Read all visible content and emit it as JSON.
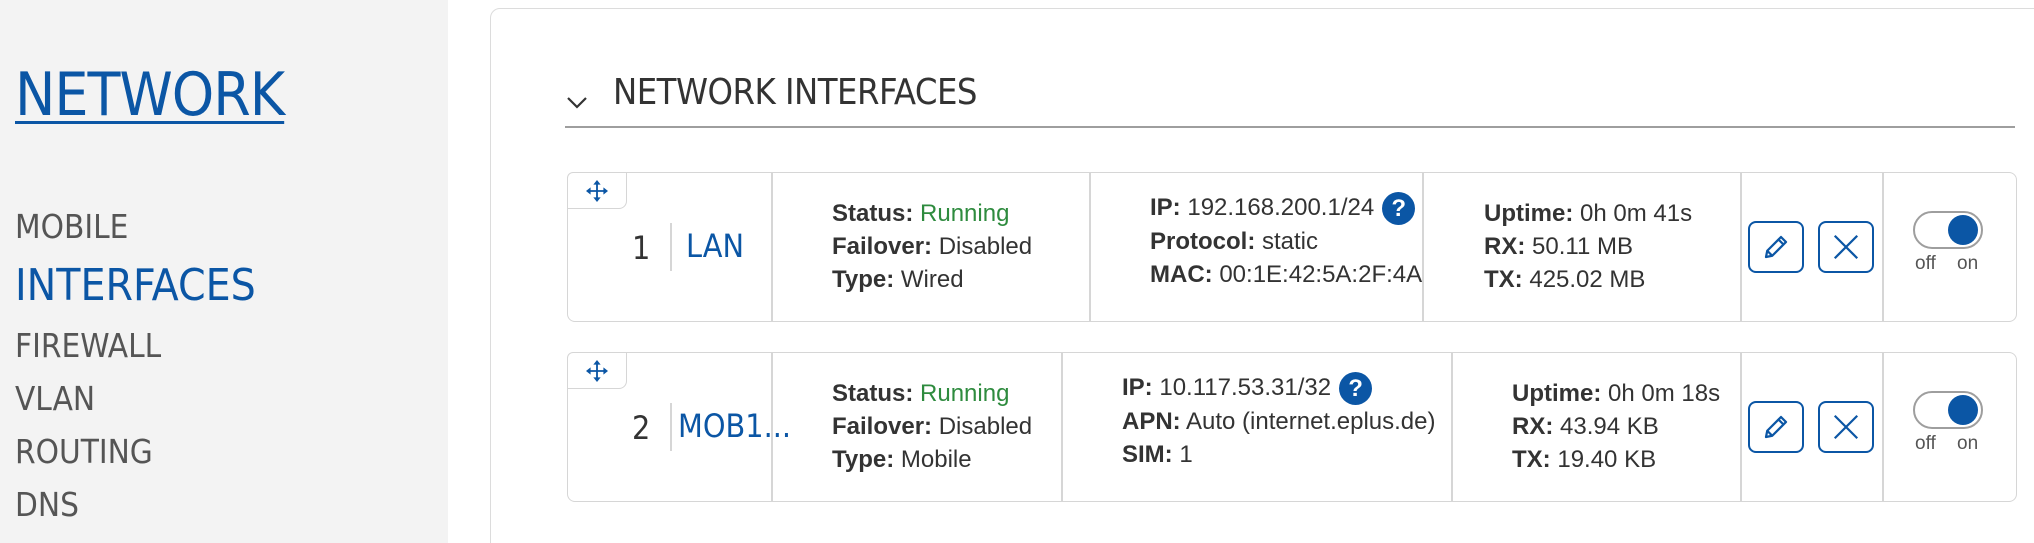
{
  "sidebar": {
    "title": "NETWORK",
    "items": [
      {
        "label": "MOBILE",
        "active": false
      },
      {
        "label": "INTERFACES",
        "active": true
      },
      {
        "label": "FIREWALL",
        "active": false
      },
      {
        "label": "VLAN",
        "active": false
      },
      {
        "label": "ROUTING",
        "active": false
      },
      {
        "label": "DNS",
        "active": false
      }
    ]
  },
  "section": {
    "title": "NETWORK INTERFACES"
  },
  "rows": [
    {
      "index": "1",
      "name": "LAN",
      "status_label": "Status:",
      "status_value": "Running",
      "failover_label": "Failover:",
      "failover_value": "Disabled",
      "type_label": "Type:",
      "type_value": "Wired",
      "ip_label": "IP:",
      "ip_value": "192.168.200.1/24",
      "line2_label": "Protocol:",
      "line2_value": "static",
      "line3_label": "MAC:",
      "line3_value": "00:1E:42:5A:2F:4A",
      "uptime_label": "Uptime:",
      "uptime_value": "0h 0m 41s",
      "rx_label": "RX:",
      "rx_value": "50.11 MB",
      "tx_label": "TX:",
      "tx_value": "425.02 MB",
      "toggle_off": "off",
      "toggle_on": "on"
    },
    {
      "index": "2",
      "name": "MOB1...",
      "status_label": "Status:",
      "status_value": "Running",
      "failover_label": "Failover:",
      "failover_value": "Disabled",
      "type_label": "Type:",
      "type_value": "Mobile",
      "ip_label": "IP:",
      "ip_value": "10.117.53.31/32",
      "line2_label": "APN:",
      "line2_value": "Auto (internet.eplus.de)",
      "line3_label": "SIM:",
      "line3_value": "1",
      "uptime_label": "Uptime:",
      "uptime_value": "0h 0m 18s",
      "rx_label": "RX:",
      "rx_value": "43.94 KB",
      "tx_label": "TX:",
      "tx_value": "19.40 KB",
      "toggle_off": "off",
      "toggle_on": "on"
    }
  ],
  "help_glyph": "?",
  "colors": {
    "accent": "#0b56a5",
    "running": "#2e8b3e",
    "sidebar_bg": "#f3f3f3"
  }
}
